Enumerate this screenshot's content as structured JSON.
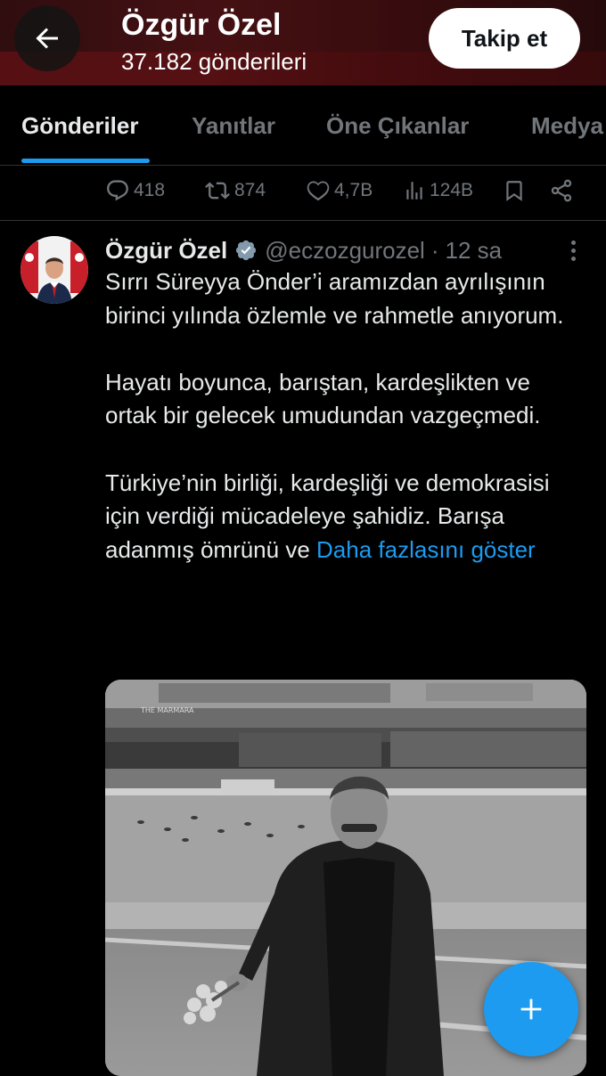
{
  "header": {
    "back_icon": "arrow-left-icon",
    "name": "Özgür Özel",
    "posts_count": "37.182 gönderileri",
    "follow_label": "Takip et"
  },
  "tabs": [
    {
      "label": "Gönderiler",
      "active": true
    },
    {
      "label": "Yanıtlar",
      "active": false
    },
    {
      "label": "Öne Çıkanlar",
      "active": false
    },
    {
      "label": "Medya",
      "active": false
    }
  ],
  "previous_tweet_actions": {
    "replies": "418",
    "reposts": "874",
    "likes": "4,7B",
    "views": "124B",
    "icons": [
      "reply-icon",
      "repost-icon",
      "like-icon",
      "views-icon",
      "bookmark-icon",
      "share-icon"
    ]
  },
  "tweet": {
    "author": "Özgür Özel",
    "handle": "@eczozgurozel",
    "separator": "·",
    "time": "12 sa",
    "paragraphs": [
      "Sırrı Süreyya Önder’i aramızdan ayrılışının birinci yılında özlemle ve rahmetle anıyorum.",
      "Hayatı boyunca, barıştan, kardeşlikten ve ortak bir gelecek umudundan vazgeçmedi.",
      "Türkiye’nin birliği, kardeşliği ve demokrasisi için verdiği mücadeleye şahidiz. Barışa adanmış ömrünü ve "
    ],
    "show_more": "Daha fazlasını göster",
    "photo_sign": "THE MARMARA"
  },
  "colors": {
    "accent": "#1d9bf0",
    "background": "#000000",
    "text": "#e7e9ea",
    "muted": "#71767b",
    "divider": "#2f3336",
    "header_red": "#6b1a1e",
    "verified": "#829aab"
  }
}
